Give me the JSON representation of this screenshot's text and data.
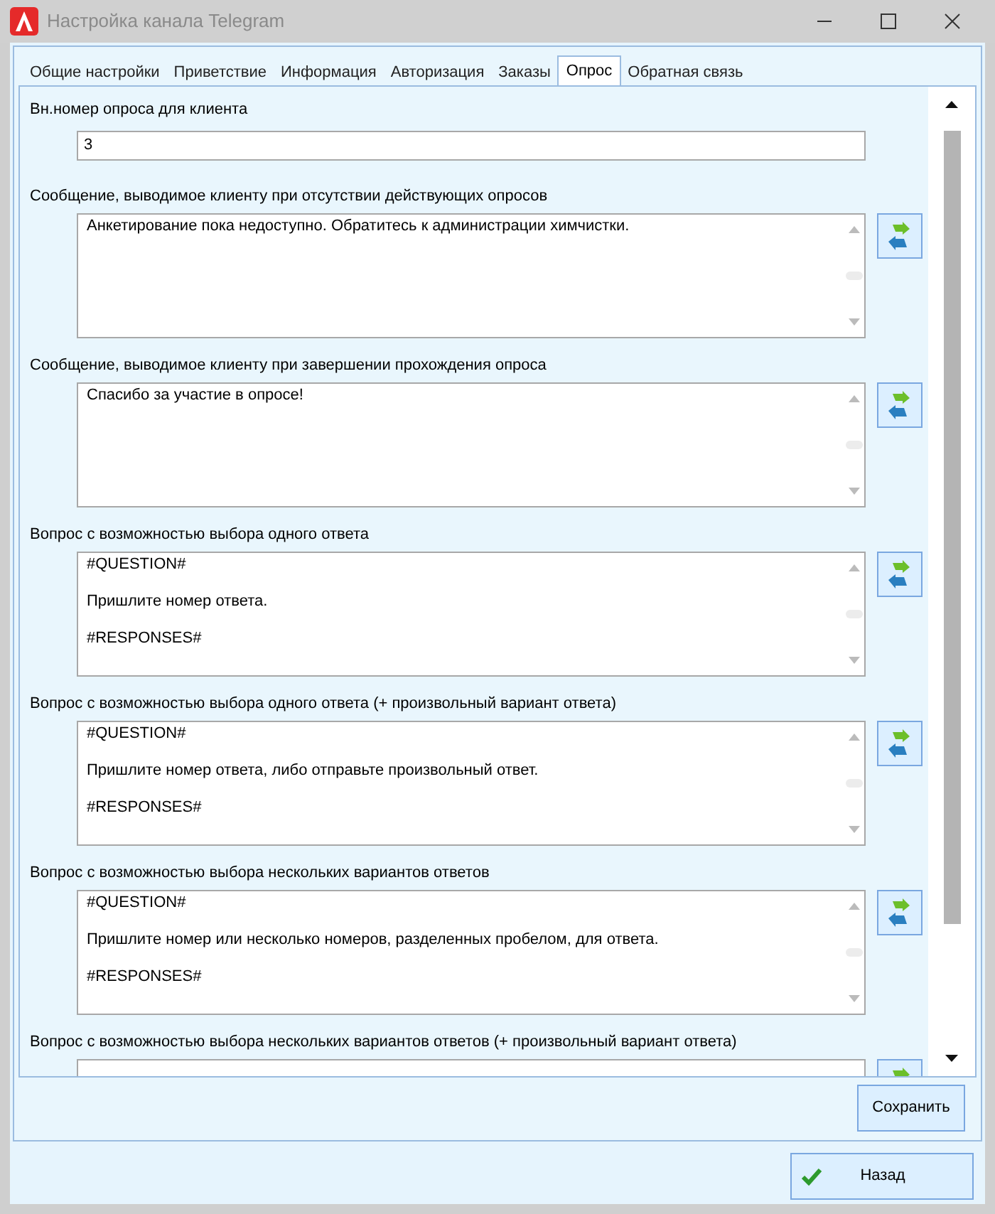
{
  "window": {
    "title": "Настройка канала Telegram"
  },
  "tabs": [
    {
      "label": "Общие настройки",
      "selected": false
    },
    {
      "label": "Приветствие",
      "selected": false
    },
    {
      "label": "Информация",
      "selected": false
    },
    {
      "label": "Авторизация",
      "selected": false
    },
    {
      "label": "Заказы",
      "selected": false
    },
    {
      "label": "Опрос",
      "selected": true
    },
    {
      "label": "Обратная связь",
      "selected": false
    }
  ],
  "sections": [
    {
      "kind": "input",
      "label": "Вн.номер опроса для клиента",
      "value": "3"
    },
    {
      "kind": "textarea",
      "label": "Сообщение, выводимое клиенту при отсутствии действующих опросов",
      "value": "Анкетирование пока недоступно. Обратитесь к администрации химчистки."
    },
    {
      "kind": "textarea",
      "label": "Сообщение, выводимое клиенту при завершении прохождения опроса",
      "value": "Спасибо за участие в опросе!"
    },
    {
      "kind": "textarea",
      "label": "Вопрос с возможностью выбора одного ответа",
      "value": "#QUESTION#\n\nПришлите номер ответа.\n\n#RESPONSES#"
    },
    {
      "kind": "textarea",
      "label": "Вопрос с возможностью выбора одного ответа (+ произвольный вариант ответа)",
      "value": "#QUESTION#\n\nПришлите номер ответа, либо отправьте произвольный ответ.\n\n#RESPONSES#"
    },
    {
      "kind": "textarea",
      "label": "Вопрос с возможностью выбора нескольких вариантов ответов",
      "value": "#QUESTION#\n\nПришлите номер или несколько номеров, разделенных пробелом, для ответа.\n\n#RESPONSES#"
    },
    {
      "kind": "textarea",
      "label": "Вопрос с возможностью выбора нескольких вариантов ответов (+ произвольный вариант ответа)"
    }
  ],
  "save_button": "Сохранить",
  "back_button": "Назад"
}
